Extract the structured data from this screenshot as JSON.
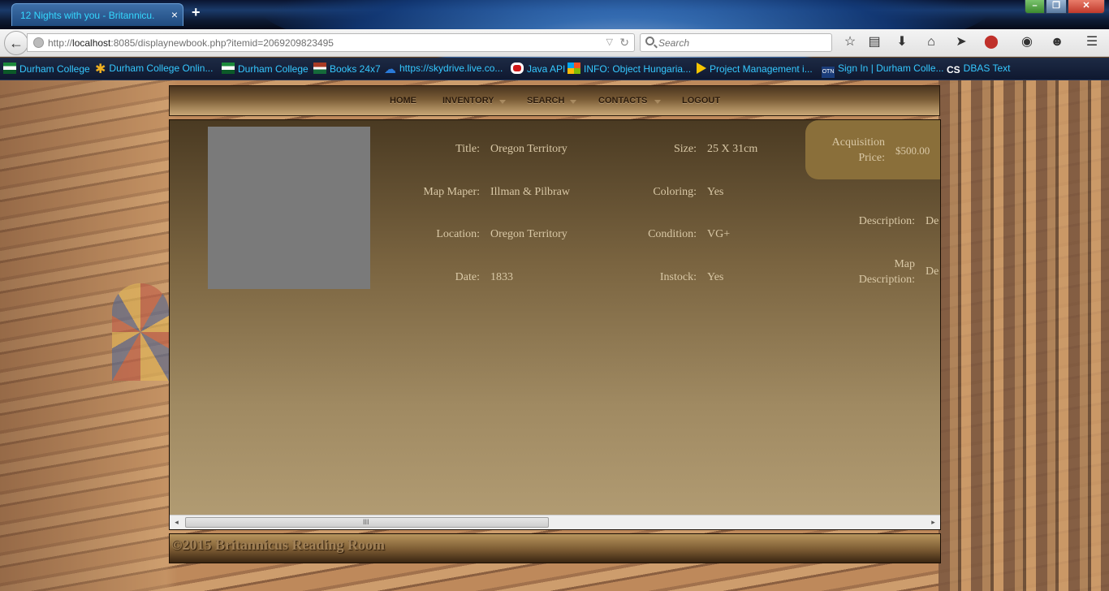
{
  "browser": {
    "tab_title": "12 Nights with you - Britannicu...",
    "tab_close": "×",
    "new_tab": "+",
    "url_host": "localhost",
    "url_prefix": "http://",
    "url_rest": ":8085/displaynewbook.php?itemid=2069209823495",
    "search_placeholder": "Search",
    "window_controls": {
      "min": "–",
      "max": "❐",
      "close": "✕"
    }
  },
  "toolbar_icons": [
    "star-icon",
    "reader-icon",
    "download-icon",
    "home-icon",
    "send-icon",
    "adblock-icon",
    "globe-addon-icon",
    "smiley-icon",
    "menu-icon"
  ],
  "bookmarks": [
    {
      "label": "Durham College",
      "icon": "flag"
    },
    {
      "label": "Durham College Onlin...",
      "icon": "star"
    },
    {
      "label": "Durham College",
      "icon": "flag"
    },
    {
      "label": "Books 24x7",
      "icon": "red"
    },
    {
      "label": "https://skydrive.live.co...",
      "icon": "cloud"
    },
    {
      "label": "Java API",
      "icon": "oracle"
    },
    {
      "label": "INFO: Object Hungaria...",
      "icon": "ms"
    },
    {
      "label": "Project Management i...",
      "icon": "tri"
    },
    {
      "label": "Sign In | Durham Colle...",
      "icon": "otn"
    },
    {
      "label": "DBAS Text",
      "icon": "cs"
    }
  ],
  "site_nav": {
    "home": "HOME",
    "inventory": "INVENTORY",
    "search": "SEARCH",
    "contacts": "CONTACTS",
    "logout": "LOGOUT"
  },
  "item": {
    "title_label": "Title:",
    "title": "Oregon Territory",
    "maker_label": "Map Maper:",
    "maker": "Illman & Pilbraw",
    "location_label": "Location:",
    "location": "Oregon Territory",
    "date_label": "Date:",
    "date": "1833",
    "size_label": "Size:",
    "size": "25 X 31cm",
    "coloring_label": "Coloring:",
    "coloring": "Yes",
    "condition_label": "Condition:",
    "condition": "VG+",
    "instock_label": "Instock:",
    "instock": "Yes",
    "acq_label_1": "Acquisition",
    "acq_label_2": "Price:",
    "acq_price": "$500.00",
    "desc_label": "Description:",
    "desc": "De",
    "mapdesc_label_1": "Map",
    "mapdesc_label_2": "Description:",
    "mapdesc": "De"
  },
  "scrollbar": {
    "left": "◂",
    "right": "▸",
    "grip": "III"
  },
  "footer": {
    "text": "©2015 Britannicus Reading Room"
  },
  "colors": {
    "tab_text": "#35d8ff",
    "bookmark_text": "#35c8ff",
    "label_text": "#d9c8a6",
    "acq_box": "#8a6f3a"
  }
}
